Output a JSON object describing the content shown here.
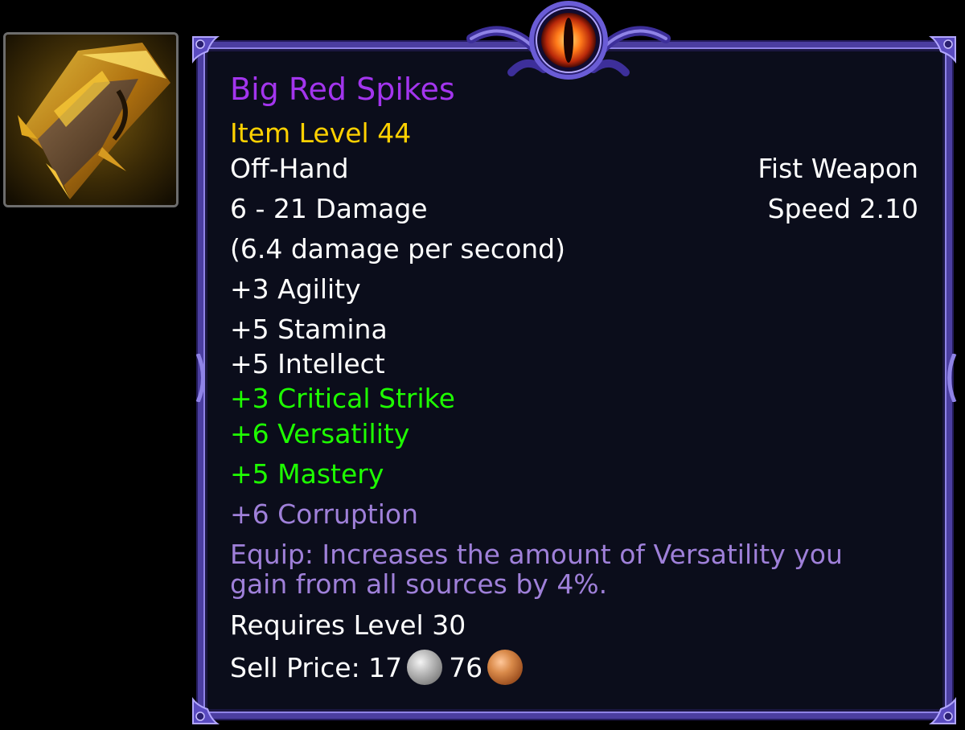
{
  "item": {
    "name": "Big Red Spikes",
    "item_level": "Item Level 44",
    "slot": "Off-Hand",
    "type": "Fist Weapon",
    "damage": "6 - 21 Damage",
    "speed": "Speed 2.10",
    "dps": "(6.4 damage per second)",
    "stats": [
      "+3 Agility",
      "+5 Stamina",
      "+5 Intellect"
    ],
    "secondary_stats": [
      "+3 Critical Strike",
      "+6 Versatility",
      "+5 Mastery"
    ],
    "corruption": "+6 Corruption",
    "equip_line1": "Equip: Increases the amount of Versatility you",
    "equip_line2": "gain from all sources by 4%.",
    "requires": "Requires Level 30",
    "sell_label": "Sell Price: 17",
    "sell_copper": "76"
  },
  "icons": {
    "item_icon": "spiked-fist-weapon-icon",
    "silver_coin": "silver-coin-icon",
    "copper_coin": "copper-coin-icon",
    "eye_ornament": "eye-ornament-icon"
  },
  "colors": {
    "name": "#a335ee",
    "item_level": "#ffd100",
    "secondary_stats": "#1eff00",
    "corruption": "#9f80d9",
    "border": "#4b3ea0",
    "background": "#0b0d1b"
  }
}
